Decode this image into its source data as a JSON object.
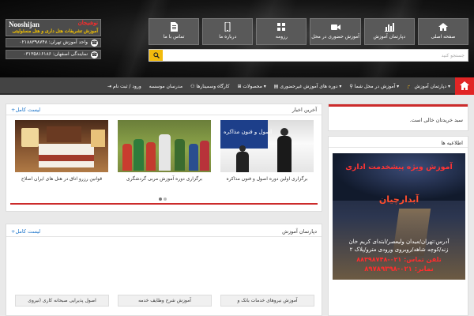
{
  "header": {
    "logo_name": "Nooshijan",
    "logo_title": "نوشیجان",
    "logo_tagline": "آموزش تشریفات هتل داری و هتل مسئولیتی",
    "branches": [
      {
        "text": "واحد آموزش تهران: ۰۲۱۸۸۳۹۸۷۴۸",
        "icon": "phone-icon"
      },
      {
        "text": "نمایندگی اصفهان: ۰۳۱۳۵۸۱۶۱۸۶",
        "icon": "phone-icon"
      }
    ],
    "nav_boxes": [
      {
        "label": "صفحه اصلی",
        "icon": "home-icon"
      },
      {
        "label": "دپارتمان آموزش",
        "icon": "bar-chart-icon"
      },
      {
        "label": "آموزش حضوری در محل",
        "icon": "video-camera-icon"
      },
      {
        "label": "رزومه",
        "icon": "grid-icon"
      },
      {
        "label": "درباره ما",
        "icon": "mobile-icon"
      },
      {
        "label": "تماس با ما",
        "icon": "document-icon"
      }
    ],
    "search_placeholder": "جستجو کنید"
  },
  "menu": {
    "home_icon": "home-icon",
    "items": [
      "دپارتمان آموزش",
      "آموزش در محل شما",
      "دوره های آموزش غیرحضوری",
      "محصولات",
      "کارگاه وسمینارها",
      "مدرسان موسسه",
      "ورود / ثبت نام"
    ]
  },
  "news": {
    "title": "آخرین اخبار",
    "more_link": "+لیست کامل",
    "items": [
      {
        "caption": "برگزاری اولین دوره اصول و فنون مذاکره",
        "overlay": "اصول و فنون مذاکره"
      },
      {
        "caption": "برگزاری دوره آموزش مربی گردشگری"
      },
      {
        "caption": "قوانین رزرو اتاق در هتل های ایران اصلاح"
      }
    ]
  },
  "department": {
    "title": "دپارتمان آموزش",
    "more_link": "+لیست کامل",
    "courses": [
      "آموزش نیروهای خدمات بانک و",
      "آموزش شرح وظایف خدمه",
      "اصول پذیرایی صبحانه کاری (نیروی"
    ]
  },
  "cart": {
    "text": "سبد خریدتان خالی است."
  },
  "notices": {
    "title": "اطلاعیه ها",
    "ad_lines": [
      "آموزش ویژه پیشخدمت اداری",
      "آبدارچیان",
      "آدرس:تهران/میدان ولیعصر/ابتدای کریم خان",
      "زند/کوچه شاهد/روبروی ورودی مترو/پلاک ۲",
      "تلفن تماس: ۰۲۱-۸۸۳۹۸۷۴۸",
      "نمابر: ۰۲۱-۸۹۷۸۹۳۹۸"
    ]
  }
}
